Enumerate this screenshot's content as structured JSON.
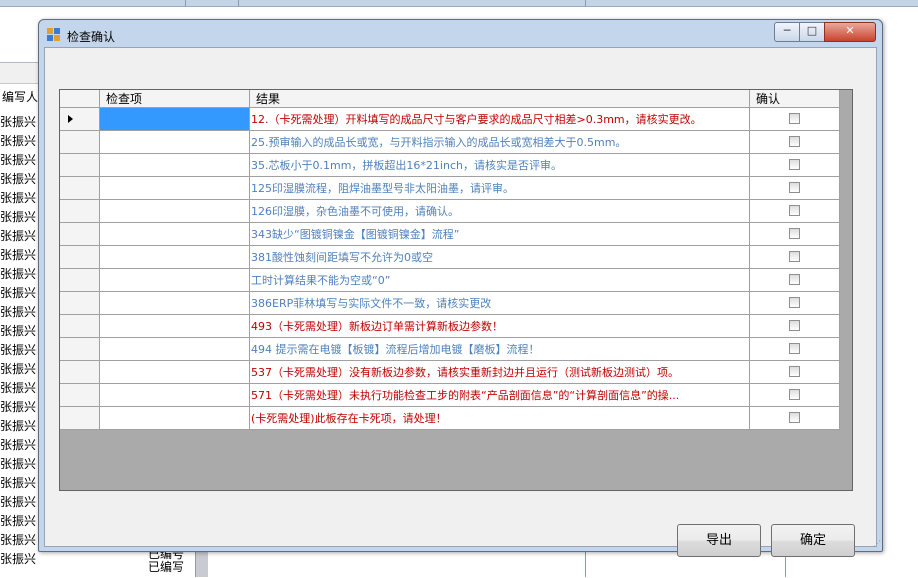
{
  "background": {
    "left_header": "编写人",
    "left_names": [
      "张振兴",
      "张振兴",
      "张振兴",
      "张振兴",
      "张振兴",
      "张振兴",
      "张振兴",
      "张振兴",
      "张振兴",
      "张振兴",
      "张振兴",
      "张振兴",
      "张振兴",
      "张振兴",
      "张振兴",
      "张振兴",
      "张振兴",
      "张振兴",
      "张振兴",
      "张振兴",
      "张振兴",
      "张振兴",
      "张振兴",
      "张振兴"
    ],
    "bottom_text": [
      "已编号",
      "已编写"
    ]
  },
  "dialog": {
    "title": "检查确认",
    "buttons": {
      "minimize": "─",
      "maximize": "□",
      "close": "✕"
    }
  },
  "grid": {
    "columns": [
      "检查项",
      "结果",
      "确认"
    ],
    "rows": [
      {
        "item": "",
        "result": "12.（卡死需处理）开料填写的成品尺寸与客户要求的成品尺寸相差>0.3mm，请核实更改。",
        "color": "red",
        "selected": true,
        "checked": false
      },
      {
        "item": "",
        "result": "25.预审输入的成品长或宽，与开料指示输入的成品长或宽相差大于0.5mm。",
        "color": "blue",
        "selected": false,
        "checked": false
      },
      {
        "item": "",
        "result": "35.芯板小于0.1mm，拼板超出16*21inch，请核实是否评审。",
        "color": "blue",
        "selected": false,
        "checked": false
      },
      {
        "item": "",
        "result": "125印湿膜流程，阻焊油墨型号非太阳油墨，请评审。",
        "color": "blue",
        "selected": false,
        "checked": false
      },
      {
        "item": "",
        "result": "126印湿膜，杂色油墨不可使用，请确认。",
        "color": "blue",
        "selected": false,
        "checked": false
      },
      {
        "item": "",
        "result": "343缺少“图镀铜镍金【图镀铜镍金】流程”",
        "color": "blue",
        "selected": false,
        "checked": false
      },
      {
        "item": "",
        "result": "381酸性蚀刻间距填写不允许为0或空",
        "color": "blue",
        "selected": false,
        "checked": false
      },
      {
        "item": "",
        "result": "工时计算结果不能为空或“0”",
        "color": "blue",
        "selected": false,
        "checked": false
      },
      {
        "item": "",
        "result": "386ERP菲林填写与实际文件不一致，请核实更改",
        "color": "blue",
        "selected": false,
        "checked": false
      },
      {
        "item": "",
        "result": "493（卡死需处理）新板边订单需计算新板边参数！",
        "color": "red",
        "selected": false,
        "checked": false
      },
      {
        "item": "",
        "result": "494 提示需在电镀【板镀】流程后增加电镀【磨板】流程！",
        "color": "blue",
        "selected": false,
        "checked": false
      },
      {
        "item": "",
        "result": "537（卡死需处理）没有新板边参数，请核实重新封边并且运行（测试新板边测试）项。",
        "color": "red",
        "selected": false,
        "checked": false
      },
      {
        "item": "",
        "result": "571（卡死需处理）未执行功能检查工步的附表“产品剖面信息”的“计算剖面信息”的操...",
        "color": "red",
        "selected": false,
        "checked": false
      },
      {
        "item": "",
        "result": "(卡死需处理)此板存在卡死项，请处理！",
        "color": "red",
        "selected": false,
        "checked": false
      }
    ]
  },
  "actions": {
    "export_label": "导出",
    "ok_label": "确定"
  },
  "colors": {
    "red_text": "#c00000",
    "blue_text": "#4f81bd",
    "grid_background": "#aaaaaa",
    "selection": "#3399ff"
  }
}
